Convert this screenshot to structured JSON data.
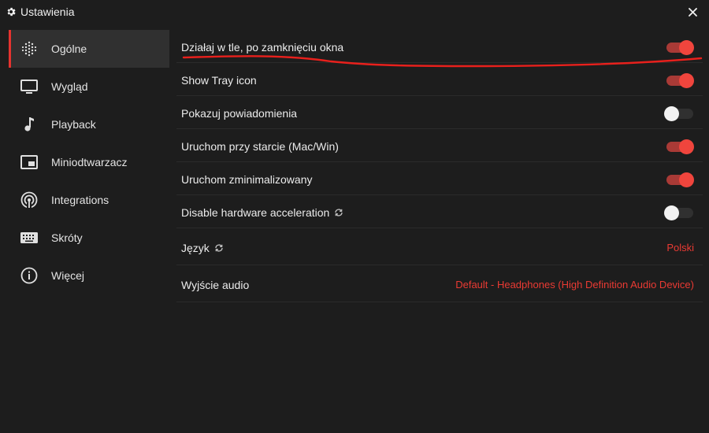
{
  "window": {
    "title": "Ustawienia",
    "icon": "gear-icon",
    "close_icon": "close-icon"
  },
  "sidebar": {
    "items": [
      {
        "label": "Ogólne",
        "icon": "equalizer-dots-icon",
        "active": true
      },
      {
        "label": "Wygląd",
        "icon": "monitor-icon",
        "active": false
      },
      {
        "label": "Playback",
        "icon": "music-note-icon",
        "active": false
      },
      {
        "label": "Miniodtwarzacz",
        "icon": "picture-in-picture-icon",
        "active": false
      },
      {
        "label": "Integrations",
        "icon": "broadcast-icon",
        "active": false
      },
      {
        "label": "Skróty",
        "icon": "keyboard-icon",
        "active": false
      },
      {
        "label": "Więcej",
        "icon": "info-icon",
        "active": false
      }
    ]
  },
  "settings": {
    "rows": [
      {
        "label": "Działaj w tle, po zamknięciu okna",
        "type": "toggle",
        "enabled": true
      },
      {
        "label": "Show Tray icon",
        "type": "toggle",
        "enabled": true
      },
      {
        "label": "Pokazuj powiadomienia",
        "type": "toggle",
        "enabled": false
      },
      {
        "label": "Uruchom przy starcie (Mac/Win)",
        "type": "toggle",
        "enabled": true
      },
      {
        "label": "Uruchom zminimalizowany",
        "type": "toggle",
        "enabled": true
      },
      {
        "label": "Disable hardware acceleration",
        "type": "toggle",
        "enabled": false,
        "restart_icon": "refresh-icon"
      },
      {
        "label": "Język",
        "type": "select",
        "value": "Polski",
        "restart_icon": "refresh-icon"
      },
      {
        "label": "Wyjście audio",
        "type": "select",
        "value": "Default - Headphones (High Definition Audio Device)"
      }
    ]
  },
  "colors": {
    "accent": "#e5332f",
    "toggle_on_knob": "#f0453d",
    "toggle_on_track": "#a93a36",
    "background": "#1d1d1d",
    "active_nav_bg": "#303030",
    "annotation_stroke": "#e8201c"
  }
}
